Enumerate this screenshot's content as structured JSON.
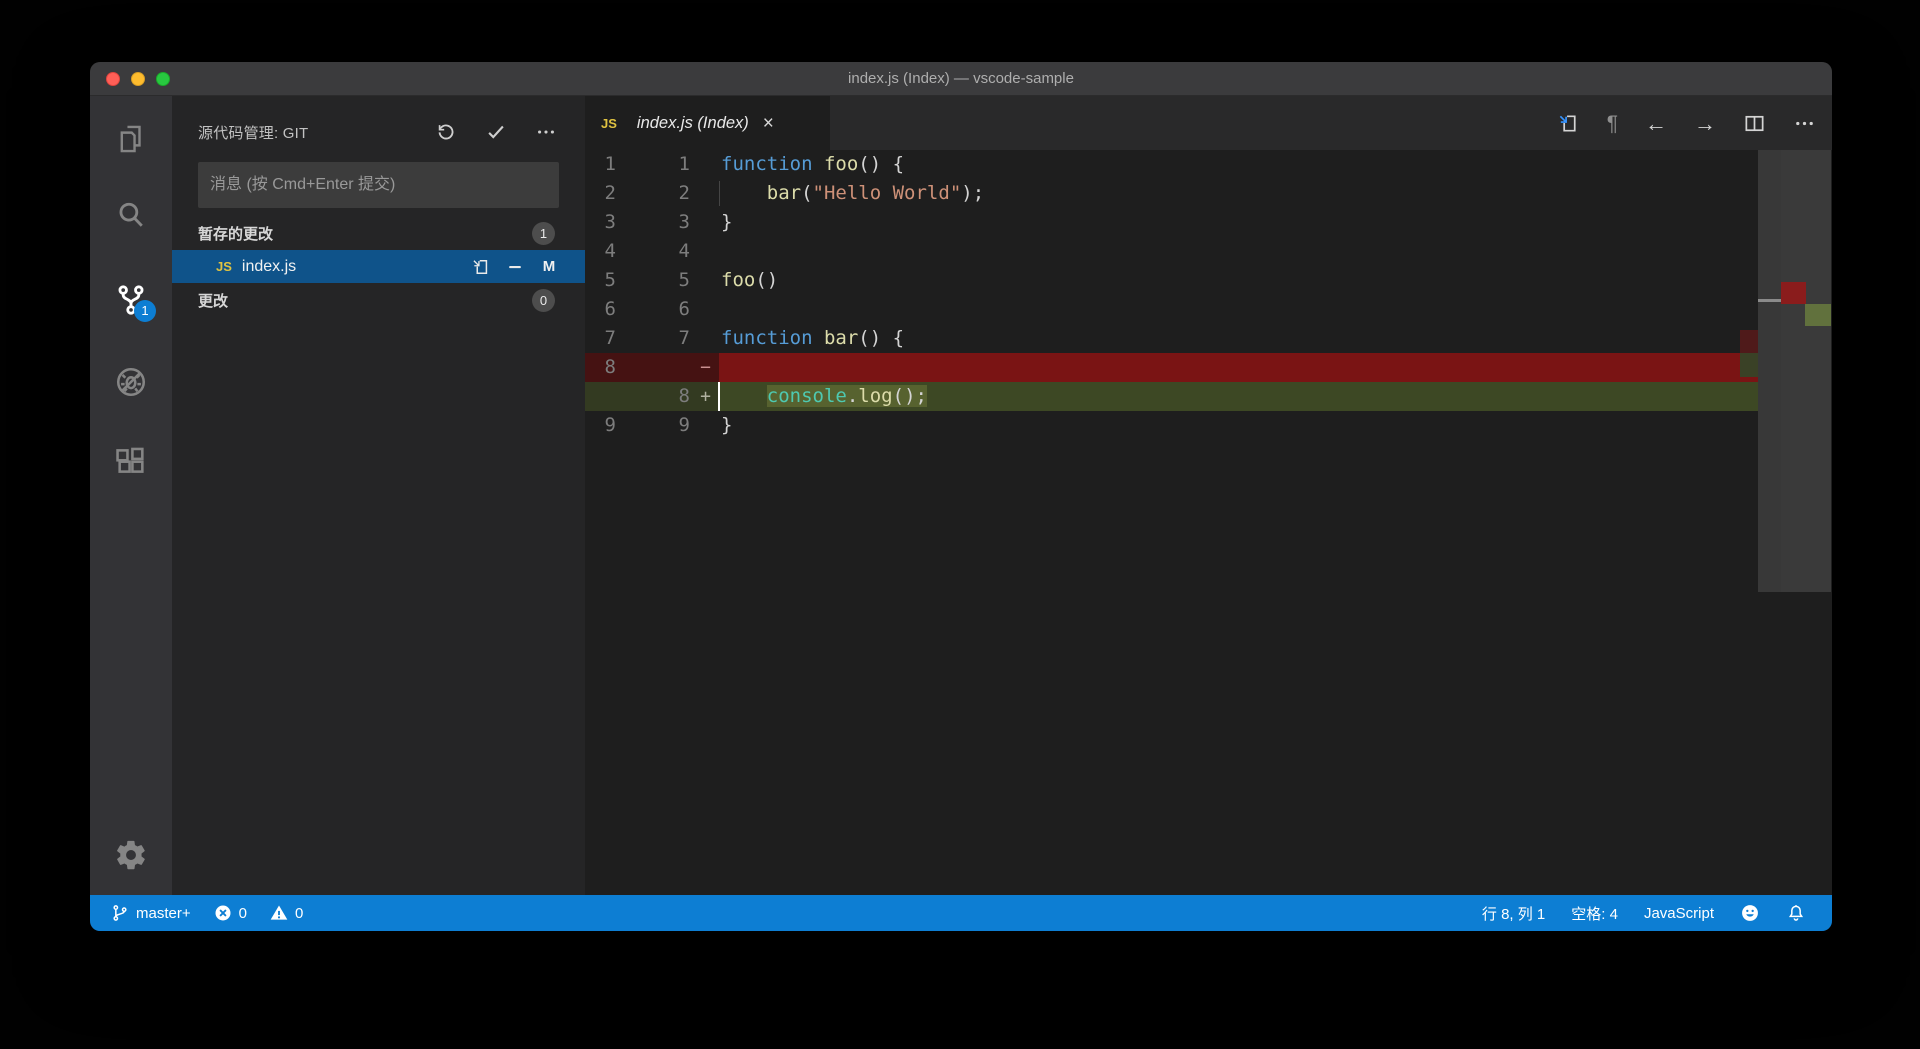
{
  "window": {
    "title": "index.js (Index) — vscode-sample"
  },
  "activity_bar": {
    "items": [
      {
        "icon": "files-icon",
        "active": false
      },
      {
        "icon": "search-icon",
        "active": false
      },
      {
        "icon": "source-control-icon",
        "active": true,
        "badge": "1"
      },
      {
        "icon": "debug-icon",
        "active": false
      },
      {
        "icon": "extensions-icon",
        "active": false
      }
    ],
    "bottom_icon": "settings-gear-icon"
  },
  "sidebar": {
    "title": "源代码管理: GIT",
    "actions": [
      "refresh-icon",
      "commit-check-icon",
      "more-actions-icon"
    ],
    "commit_input": {
      "placeholder": "消息 (按 Cmd+Enter 提交)",
      "value": ""
    },
    "sections": [
      {
        "label": "暂存的更改",
        "badge": "1",
        "items": [
          {
            "icon": "js-file-icon",
            "file": "index.js",
            "selected": true,
            "actions": [
              "open-file-icon",
              "unstage-icon"
            ],
            "status": "M"
          }
        ]
      },
      {
        "label": "更改",
        "badge": "0",
        "items": []
      }
    ]
  },
  "editor": {
    "tab": {
      "icon": "js-file-icon",
      "icon_text": "JS",
      "label": "index.js (Index)",
      "close": "×"
    },
    "toolbar": {
      "whitespace": "¶",
      "back": "←",
      "forward": "→"
    },
    "diff_lines": [
      {
        "old": "1",
        "new": "1",
        "tokens": [
          [
            "kw",
            "function "
          ],
          [
            "fn",
            "foo"
          ],
          [
            "pl",
            "() {"
          ]
        ]
      },
      {
        "old": "2",
        "new": "2",
        "guide": true,
        "tokens": [
          [
            "pl",
            "    "
          ],
          [
            "fn",
            "bar"
          ],
          [
            "pl",
            "("
          ],
          [
            "str",
            "\"Hello World\""
          ],
          [
            "pl",
            ");"
          ]
        ]
      },
      {
        "old": "3",
        "new": "3",
        "tokens": [
          [
            "pl",
            "}"
          ]
        ]
      },
      {
        "old": "4",
        "new": "4",
        "tokens": []
      },
      {
        "old": "5",
        "new": "5",
        "tokens": [
          [
            "fn",
            "foo"
          ],
          [
            "pl",
            "()"
          ]
        ]
      },
      {
        "old": "6",
        "new": "6",
        "tokens": []
      },
      {
        "old": "7",
        "new": "7",
        "tokens": [
          [
            "kw",
            "function "
          ],
          [
            "fn",
            "bar"
          ],
          [
            "pl",
            "() {"
          ]
        ]
      },
      {
        "old": "8",
        "new": "",
        "type": "del",
        "marker": "−",
        "tokens": []
      },
      {
        "old": "",
        "new": "8",
        "type": "add",
        "marker": "+",
        "cursor": true,
        "tokens": [
          [
            "pl",
            "    "
          ],
          [
            "cls",
            "console",
            "hl"
          ],
          [
            "pl",
            ".",
            "hl"
          ],
          [
            "fn",
            "log",
            "hl"
          ],
          [
            "pl",
            "();",
            "hl"
          ]
        ]
      },
      {
        "old": "9",
        "new": "9",
        "tokens": [
          [
            "pl",
            "}"
          ]
        ]
      }
    ]
  },
  "status_bar": {
    "branch": "master+",
    "errors": "0",
    "warnings": "0",
    "cursor_position": "行 8, 列 1",
    "indentation": "空格: 4",
    "language": "JavaScript"
  },
  "colors": {
    "status_bar": "#0d7ed3",
    "activity_badge": "#0d7ed3",
    "selection": "#0f538a",
    "js_icon": "#e0c341",
    "diff_removed": "#7a1414",
    "diff_removed_gutter": "#451212",
    "diff_added": "#3d4824",
    "diff_added_inline": "#57622f",
    "ruler_removed": "#8a1c1c",
    "ruler_added": "#61713d"
  }
}
